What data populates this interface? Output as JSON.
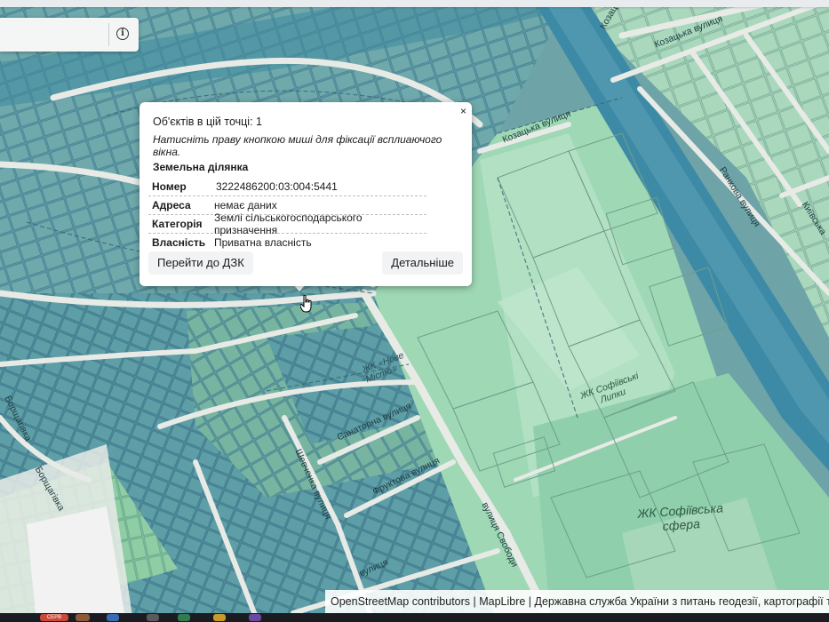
{
  "popup": {
    "close_label": "×",
    "object_count": "Об'єктів в цій точці: 1",
    "hint": "Натисніть праву кнопкою миші для фіксації всплиаючого вікна.",
    "object_type": "Земельна ділянка",
    "attributes": [
      {
        "key": "Номер",
        "value": "3222486200:03:004:5441"
      },
      {
        "key": "Адреса",
        "value": "немає даних"
      },
      {
        "key": "Категорія",
        "value": "Землі сільськогосподарського призначення"
      },
      {
        "key": "Власність",
        "value": "Приватна власність"
      }
    ],
    "go_to_dzk_label": "Перейти до ДЗК",
    "details_label": "Детальніше"
  },
  "toolbar": {
    "info_label": "i"
  },
  "map": {
    "labels": {
      "kozatska_1": "Козацька вулиця",
      "kozatska_2": "Козацька вулиця",
      "kozatska_3": "Козацька",
      "rankova": "Ранкова вулиця",
      "kyivska": "Київська",
      "borshchahivka": "Борщагівка",
      "borshchahivka_2": "Борщагівка",
      "sanatorna": "Санаторна вулиця",
      "fruktova": "Фруктова вулиця",
      "shevchenka": "Шевченка вулиця",
      "svobody": "вулиця Свободи",
      "street_bottom": "вулиця",
      "zhk_lypky": "ЖК Софіївські Липки",
      "zhk_sfera_1": "ЖК Софіївська",
      "zhk_sfera_2": "сфера",
      "zhk_misto": "ЖК «Нове Місто»"
    },
    "colors": {
      "parcel_blue": "#4f8ea0",
      "parcel_teal": "#6aa89a",
      "parcel_green": "#7fc49a",
      "residential_green": "#9fd9b6",
      "road": "#e7e9e5",
      "highway": "#3d8aa6"
    }
  },
  "attribution": "OpenStreetMap contributors | MapLibre | Державна служба України з питань геодезії, картографії та кадастру",
  "taskbar": {
    "badge": "СЕРВ"
  }
}
